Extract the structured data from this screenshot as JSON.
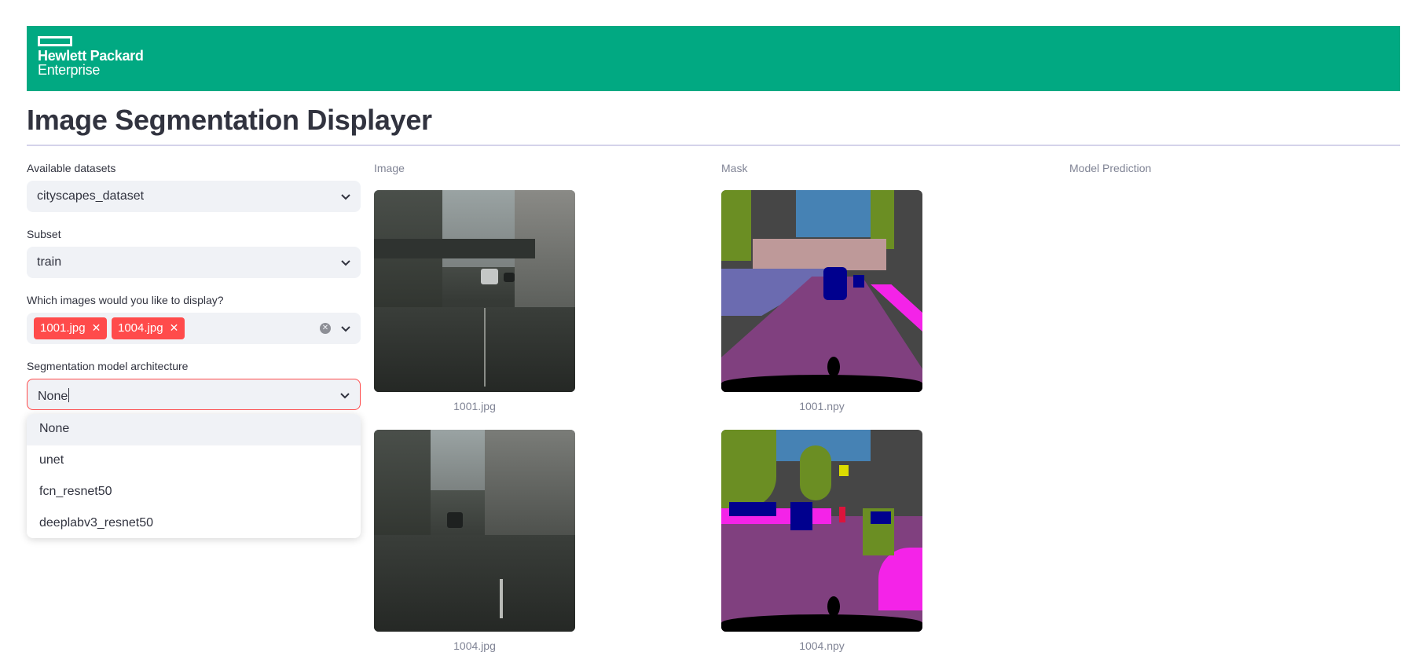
{
  "brand": {
    "line1": "Hewlett Packard",
    "line2": "Enterprise",
    "color": "#01a982"
  },
  "page_title": "Image Segmentation Displayer",
  "sidebar": {
    "dataset": {
      "label": "Available datasets",
      "value": "cityscapes_dataset"
    },
    "subset": {
      "label": "Subset",
      "value": "train"
    },
    "images": {
      "label": "Which images would you like to display?",
      "tags": [
        {
          "label": "1001.jpg"
        },
        {
          "label": "1004.jpg"
        }
      ]
    },
    "model": {
      "label": "Segmentation model architecture",
      "value": "None",
      "options": [
        "None",
        "unet",
        "fcn_resnet50",
        "deeplabv3_resnet50"
      ]
    }
  },
  "columns": {
    "image": "Image",
    "mask": "Mask",
    "prediction": "Model Prediction"
  },
  "rows": [
    {
      "image_caption": "1001.jpg",
      "mask_caption": "1001.npy"
    },
    {
      "image_caption": "1004.jpg",
      "mask_caption": "1004.npy"
    }
  ],
  "colors": {
    "accent": "#ff4b4b",
    "input_bg": "#f0f2f6",
    "text": "#31333f",
    "muted": "#808495"
  },
  "icons": {
    "chevron": "chevron-down-icon",
    "tag_remove": "close-icon",
    "clear": "clear-all-icon"
  }
}
